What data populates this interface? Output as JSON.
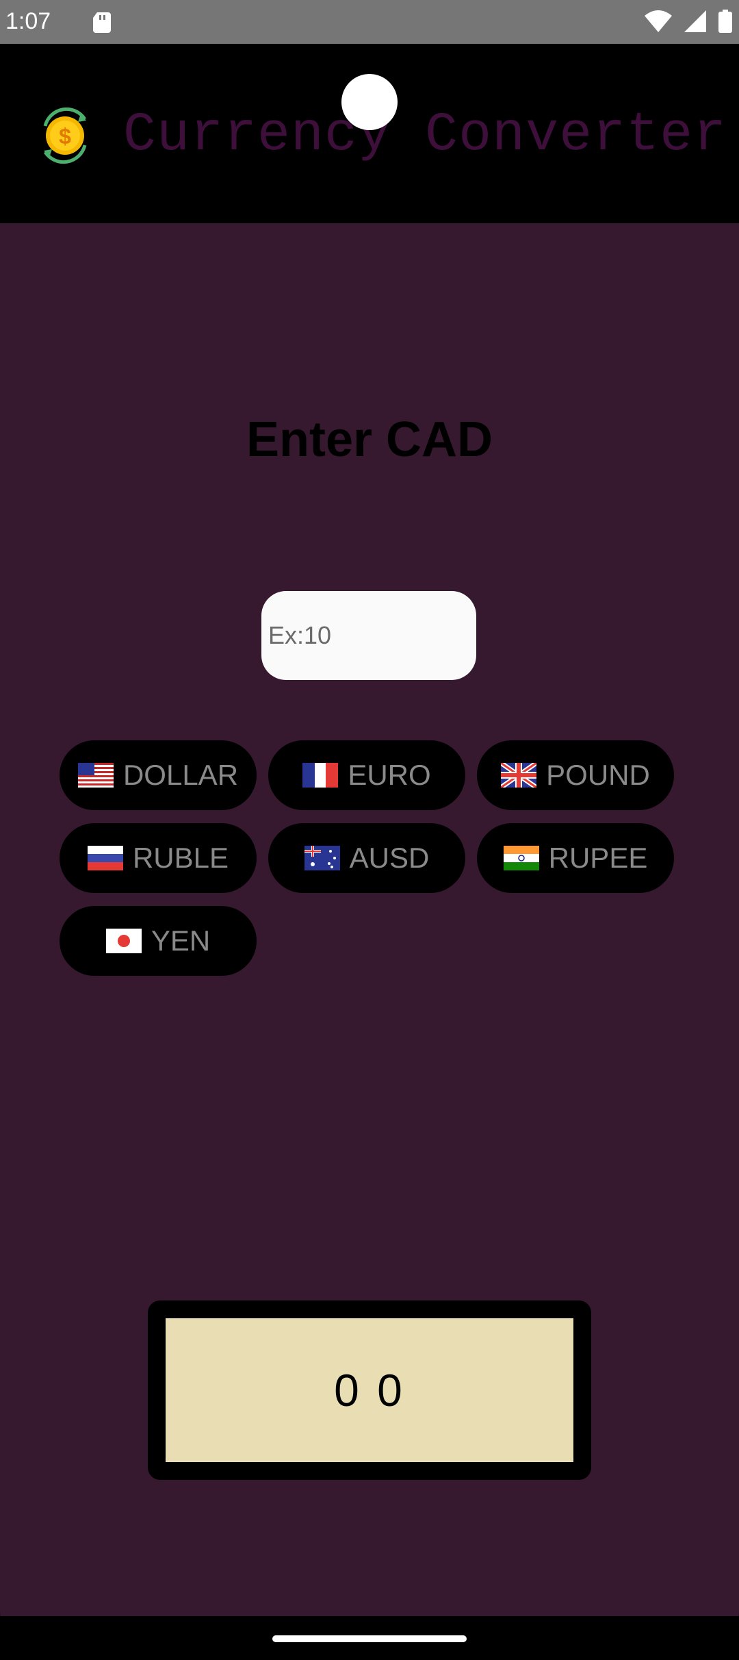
{
  "status_bar": {
    "time": "1:07"
  },
  "app": {
    "title": "Currency Converter"
  },
  "main": {
    "heading": "Enter CAD",
    "input": {
      "placeholder": "Ex:10",
      "value": ""
    },
    "currencies": [
      {
        "label": "DOLLAR",
        "flag": "us-flag"
      },
      {
        "label": "EURO",
        "flag": "france-flag"
      },
      {
        "label": "POUND",
        "flag": "uk-flag"
      },
      {
        "label": "RUBLE",
        "flag": "russia-flag"
      },
      {
        "label": "AUSD",
        "flag": "australia-flag"
      },
      {
        "label": "RUPEE",
        "flag": "india-flag"
      },
      {
        "label": "YEN",
        "flag": "japan-flag"
      }
    ],
    "result": "0 0"
  },
  "colors": {
    "background": "#36182f",
    "title": "#3d0f3a",
    "result_bg": "#e9deb3",
    "chip_text": "#8a8a8a"
  }
}
